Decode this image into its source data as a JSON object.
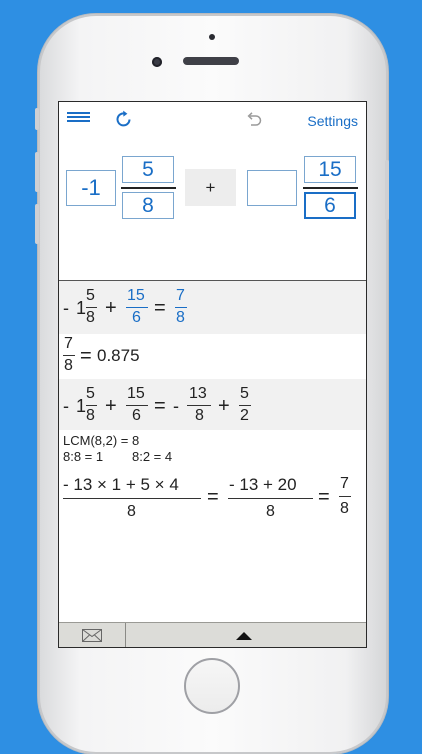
{
  "toolbar": {
    "settings_label": "Settings"
  },
  "input": {
    "whole1": "-1",
    "num1": "5",
    "den1": "8",
    "operator": "+",
    "whole2": "",
    "num2": "15",
    "den2": "6"
  },
  "steps": {
    "s1": {
      "minus": "-",
      "whole": "1",
      "num1": "5",
      "den1": "8",
      "plus": "+",
      "num2": "15",
      "den2": "6",
      "eq": "=",
      "rnum": "7",
      "rden": "8"
    },
    "s2": {
      "num": "7",
      "den": "8",
      "eq": "=",
      "decimal": "0.875"
    },
    "s3": {
      "minus": "-",
      "whole": "1",
      "num1": "5",
      "den1": "8",
      "plus": "+",
      "num2": "15",
      "den2": "6",
      "eq": "=",
      "minus2": "-",
      "num3": "13",
      "den3": "8",
      "plus2": "+",
      "num4": "5",
      "den4": "2"
    },
    "s4": {
      "lcm": "LCM(8,2) = 8",
      "factor1": "8:8 = 1",
      "factor2": "8:2 = 4"
    },
    "s5": {
      "num1": "- 13 × 1 + 5 × 4",
      "den1": "8",
      "eq1": "=",
      "num2": "- 13 + 20",
      "den2": "8",
      "eq2": "=",
      "num3": "7",
      "den3": "8"
    }
  },
  "colors": {
    "accent": "#1a6ec6",
    "background": "#2e8fe3"
  }
}
